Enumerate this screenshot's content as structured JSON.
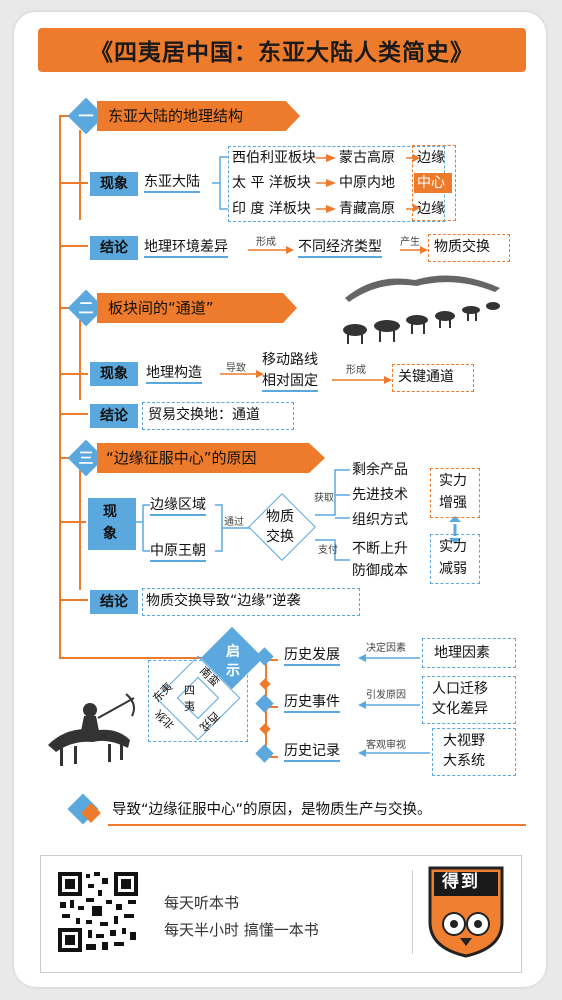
{
  "title": "《四夷居中国：东亚大陆人类简史》",
  "section1": {
    "number": "一",
    "title": "东亚大陆的地理结构",
    "phenomenon_tag": "现象",
    "continent": "东亚大陆",
    "plates": [
      "西伯利亚板块",
      "太 平 洋板块",
      "印 度 洋板块"
    ],
    "regions": [
      "蒙古高原",
      "中原内地",
      "青藏高原"
    ],
    "positions": [
      "边缘",
      "中心",
      "边缘"
    ],
    "conclusion_tag": "结论",
    "cause": "地理环境差异",
    "verb1": "形成",
    "effect": "不同经济类型",
    "verb2": "产生",
    "result": "物质交换"
  },
  "section2": {
    "number": "二",
    "title": "板块间的“通道”",
    "phenomenon_tag": "现象",
    "structure": "地理构造",
    "verb1": "导致",
    "route_line1": "移动路线",
    "route_line2": "相对固定",
    "verb2": "形成",
    "result": "关键通道",
    "conclusion_tag": "结论",
    "conclusion": "贸易交换地：通道"
  },
  "section3": {
    "number": "三",
    "title": "“边缘征服中心”的原因",
    "phenomenon_tag_1": "现",
    "phenomenon_tag_2": "象",
    "edge": "边缘区域",
    "center": "中原王朝",
    "via": "通过",
    "exchange_1": "物质",
    "exchange_2": "交换",
    "gain": "获取",
    "pay": "支付",
    "gains": [
      "剩余产品",
      "先进技术",
      "组织方式"
    ],
    "costs": [
      "不断上升",
      "防御成本"
    ],
    "strong_1": "实力",
    "strong_2": "增强",
    "weak_1": "实力",
    "weak_2": "减弱",
    "conclusion_tag": "结论",
    "conclusion": "物质交换导致“边缘”逆袭"
  },
  "enlighten": {
    "label_1": "启",
    "label_2": "示",
    "items": [
      {
        "left": "历史发展",
        "verb": "决定因素",
        "right_1": "地理因素",
        "right_2": ""
      },
      {
        "left": "历史事件",
        "verb": "引发原因",
        "right_1": "人口迁移",
        "right_2": "文化差异"
      },
      {
        "left": "历史记录",
        "verb": "客观审视",
        "right_1": "大视野",
        "right_2": "大系统"
      }
    ],
    "barbarians": {
      "center": "四夷",
      "n": "南蛮",
      "e": "东夷",
      "s": "北狄",
      "w": "西戎"
    }
  },
  "summary": "导致“边缘征服中心”的原因，是物质生产与交换。",
  "footer": {
    "line1": "每天听本书",
    "line2": "每天半小时 搞懂一本书",
    "logo": "得到"
  },
  "colors": {
    "orange": "#ee7a2c",
    "blue": "#5aa8de"
  }
}
